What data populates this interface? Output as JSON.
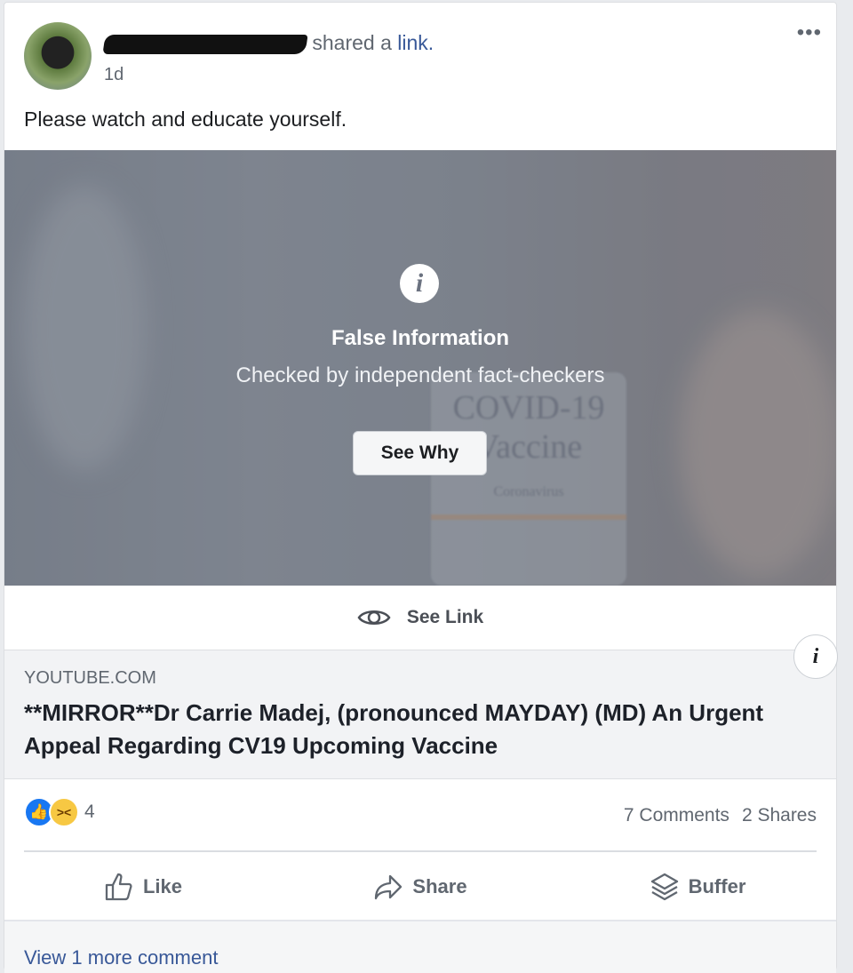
{
  "post": {
    "author_redacted": true,
    "action_text": "shared a",
    "action_link": "link.",
    "time": "1d",
    "menu_icon": "more-dots-icon",
    "message": "Please watch and educate yourself."
  },
  "media": {
    "image_text": {
      "line1": "COVID-19",
      "line2": "Vaccine",
      "line3": "Coronavirus"
    },
    "warning_title": "False Information",
    "warning_subtitle": "Checked by independent fact-checkers",
    "see_why_label": "See Why",
    "see_link_label": "See Link"
  },
  "link_preview": {
    "domain": "YOUTUBE.COM",
    "title": "**MIRROR**Dr Carrie Madej, (pronounced MAYDAY) (MD) An Urgent Appeal Regarding CV19 Upcoming Vaccine"
  },
  "engagement": {
    "reaction_count": "4",
    "comments": "7 Comments",
    "shares": "2 Shares"
  },
  "actions": {
    "like": "Like",
    "share": "Share",
    "buffer": "Buffer"
  },
  "comments": {
    "view_more": "View 1 more comment"
  },
  "colors": {
    "link": "#385898",
    "like_blue": "#1877f2",
    "haha_yellow": "#f7c843"
  }
}
